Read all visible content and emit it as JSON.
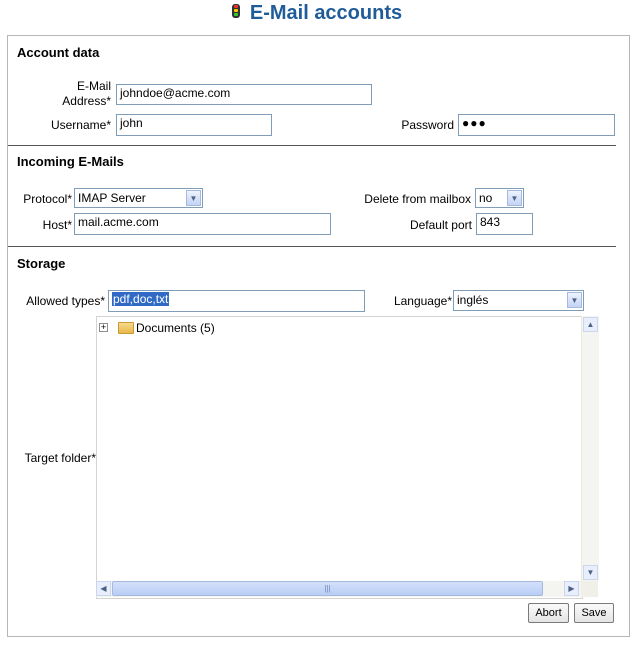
{
  "page": {
    "title": "E-Mail accounts"
  },
  "account": {
    "section_title": "Account data",
    "email_label_line1": "E-Mail",
    "email_label_line2": "Address*",
    "email_value": "johndoe@acme.com",
    "username_label": "Username*",
    "username_value": "john",
    "password_label": "Password",
    "password_value": "●●●"
  },
  "incoming": {
    "section_title": "Incoming E-Mails",
    "protocol_label": "Protocol*",
    "protocol_value": "IMAP Server",
    "delete_label": "Delete from mailbox",
    "delete_value": "no",
    "host_label": "Host*",
    "host_value": "mail.acme.com",
    "port_label": "Default port",
    "port_value": "843"
  },
  "storage": {
    "section_title": "Storage",
    "allowed_types_label": "Allowed types*",
    "allowed_types_value": "pdf,doc,txt",
    "language_label": "Language*",
    "language_value": "inglés",
    "target_folder_label": "Target folder*",
    "tree": [
      {
        "expander": "+",
        "label": "Documents (5)"
      }
    ]
  },
  "buttons": {
    "abort": "Abort",
    "save": "Save"
  },
  "colors": {
    "title": "#1f5c99",
    "selection": "#316ac5",
    "input_border": "#7f9db9"
  }
}
